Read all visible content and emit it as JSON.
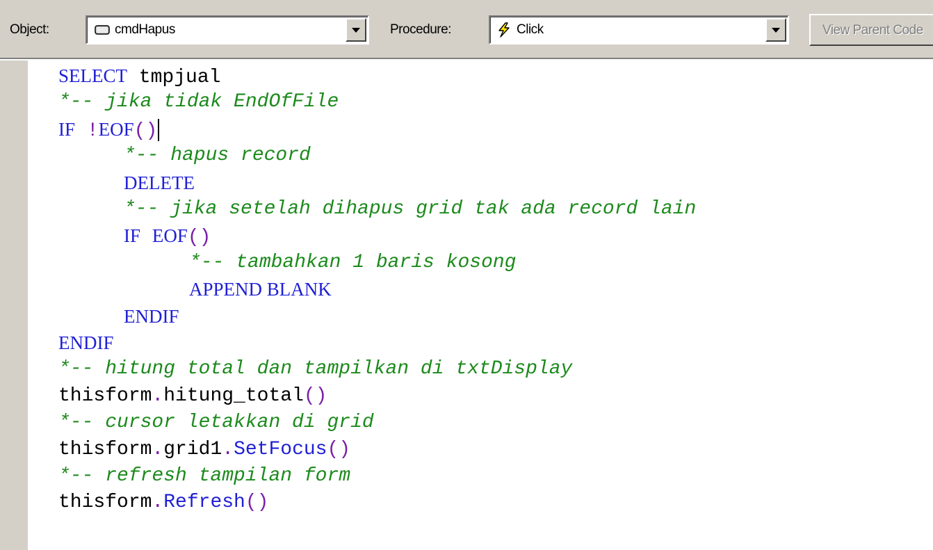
{
  "toolbar": {
    "object_label": "Object:",
    "object_value": "cmdHapus",
    "object_icon": "command-button-icon",
    "procedure_label": "Procedure:",
    "procedure_value": "Click",
    "procedure_icon": "event-lightning-icon",
    "view_parent_label": "View Parent Code"
  },
  "editor": {
    "lines": [
      {
        "indent": 0,
        "tokens": [
          {
            "t": "kw",
            "v": "SELECT"
          },
          {
            "t": "id",
            "v": " tmpjual"
          }
        ]
      },
      {
        "indent": 0,
        "tokens": [
          {
            "t": "cm",
            "v": "*-- jika tidak EndOfFile"
          }
        ]
      },
      {
        "indent": 0,
        "tokens": [
          {
            "t": "kw",
            "v": "IF"
          },
          {
            "t": "id",
            "v": " "
          },
          {
            "t": "op",
            "v": "!"
          },
          {
            "t": "kw",
            "v": "EOF"
          },
          {
            "t": "op",
            "v": "()"
          }
        ],
        "caret": true
      },
      {
        "indent": 1,
        "tokens": [
          {
            "t": "cm",
            "v": "*-- hapus record"
          }
        ]
      },
      {
        "indent": 1,
        "tokens": [
          {
            "t": "kw",
            "v": "DELETE"
          }
        ]
      },
      {
        "indent": 1,
        "tokens": [
          {
            "t": "cm",
            "v": "*-- jika setelah dihapus grid tak ada record lain"
          }
        ]
      },
      {
        "indent": 1,
        "tokens": [
          {
            "t": "kw",
            "v": "IF"
          },
          {
            "t": "id",
            "v": " "
          },
          {
            "t": "kw",
            "v": "EOF"
          },
          {
            "t": "op",
            "v": "()"
          }
        ]
      },
      {
        "indent": 2,
        "tokens": [
          {
            "t": "cm",
            "v": "*-- tambahkan 1 baris kosong"
          }
        ]
      },
      {
        "indent": 2,
        "tokens": [
          {
            "t": "kw",
            "v": "APPEND BLANK"
          }
        ]
      },
      {
        "indent": 1,
        "tokens": [
          {
            "t": "kw",
            "v": "ENDIF"
          }
        ]
      },
      {
        "indent": 0,
        "tokens": [
          {
            "t": "kw",
            "v": "ENDIF"
          }
        ]
      },
      {
        "indent": 0,
        "tokens": [
          {
            "t": "cm",
            "v": "*-- hitung total dan tampilkan di txtDisplay"
          }
        ]
      },
      {
        "indent": 0,
        "tokens": [
          {
            "t": "id",
            "v": "thisform"
          },
          {
            "t": "op",
            "v": "."
          },
          {
            "t": "id",
            "v": "hitung_total"
          },
          {
            "t": "op",
            "v": "()"
          }
        ]
      },
      {
        "indent": 0,
        "tokens": [
          {
            "t": "cm",
            "v": "*-- cursor letakkan di grid"
          }
        ]
      },
      {
        "indent": 0,
        "tokens": [
          {
            "t": "id",
            "v": "thisform"
          },
          {
            "t": "op",
            "v": "."
          },
          {
            "t": "id",
            "v": "grid1"
          },
          {
            "t": "op",
            "v": "."
          },
          {
            "t": "fn",
            "v": "SetFocus"
          },
          {
            "t": "op",
            "v": "()"
          }
        ]
      },
      {
        "indent": 0,
        "tokens": [
          {
            "t": "cm",
            "v": "*-- refresh tampilan form"
          }
        ]
      },
      {
        "indent": 0,
        "tokens": [
          {
            "t": "id",
            "v": "thisform"
          },
          {
            "t": "op",
            "v": "."
          },
          {
            "t": "fn",
            "v": "Refresh"
          },
          {
            "t": "op",
            "v": "()"
          }
        ]
      }
    ]
  },
  "colors": {
    "keyword": "#1f1fd6",
    "comment": "#1c8a1c",
    "operator": "#7a1fa8",
    "identifier": "#000000",
    "toolbar_bg": "#d4d0c8"
  }
}
